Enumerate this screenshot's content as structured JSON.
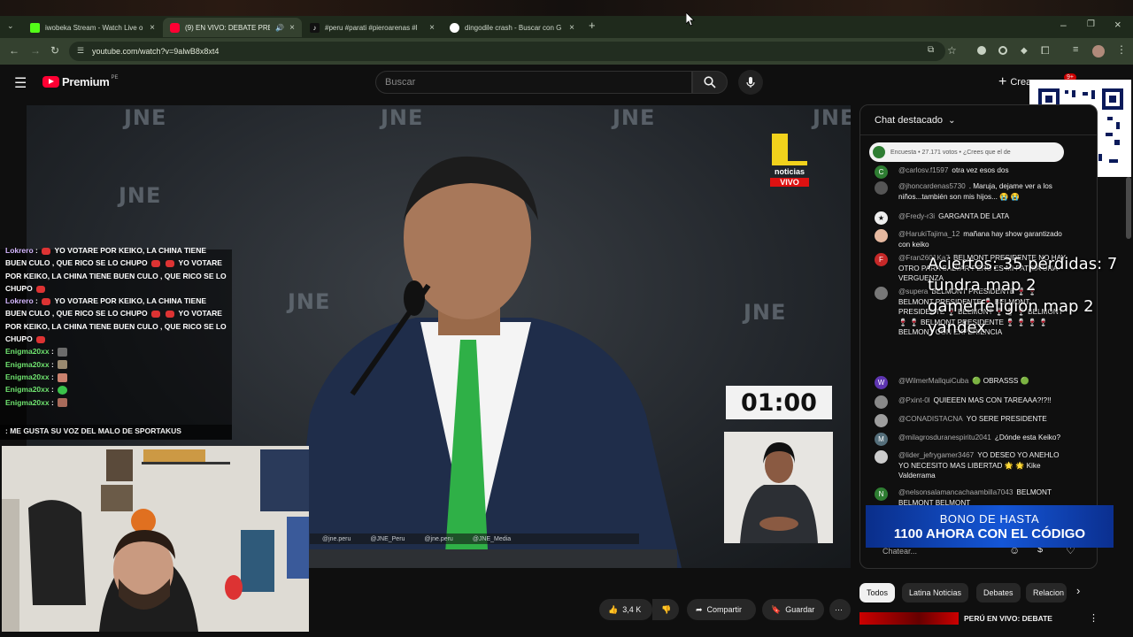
{
  "browser": {
    "tabs": [
      {
        "title": "iwobeka Stream - Watch Live o",
        "fav": "#53fc18",
        "active": false
      },
      {
        "title": "(9) EN VIVO: DEBATE PRESI",
        "fav": "#ff0033",
        "active": true
      },
      {
        "title": "#peru #parati #pieroarenas #l",
        "fav": "#111111",
        "active": false
      },
      {
        "title": "dingodile crash - Buscar con G",
        "fav": "#ffffff",
        "active": false
      }
    ],
    "url": "youtube.com/watch?v=9alwB8x8xt4"
  },
  "youtube": {
    "logo_text": "Premium",
    "region": "PE",
    "search_placeholder": "Buscar",
    "create_label": "Crear",
    "notif_count": "9+"
  },
  "video": {
    "watermark": "JNE",
    "channel_logo_label": "noticias",
    "channel_live_label": "VIVO",
    "timer": "01:00",
    "socials": [
      "@jne.peru",
      "@JNE_Peru",
      "@jne.peru",
      "@JNE_Media"
    ]
  },
  "overlay_chat": [
    {
      "user": "Lokrero",
      "text": "YO VOTARE POR KEIKO, LA CHINA TIENE BUEN CULO , QUE RICO SE LO CHUPO",
      "text2": "YO VOTARE POR KEIKO, LA CHINA TIENE BUEN CULO , QUE RICO SE LO CHUPO",
      "partial": true
    },
    {
      "user": "Lokrero",
      "text": "YO VOTARE POR KEIKO, LA CHINA TIENE BUEN CULO , QUE RICO SE LO CHUPO",
      "text2": "YO VOTARE POR KEIKO, LA CHINA TIENE BUEN CULO , QUE RICO SE LO CHUPO",
      "partial": false
    },
    {
      "user": "Enigma20xx",
      "emote": "#6b6b6b"
    },
    {
      "user": "Enigma20xx",
      "emote": "#9a8a70"
    },
    {
      "user": "Enigma20xx",
      "emote": "#c9816e"
    },
    {
      "user": "Enigma20xx",
      "emote": "#3ac24a"
    },
    {
      "user": "Enigma20xx",
      "emote": "#a86a5a"
    }
  ],
  "overlay_last": "ME GUSTA SU VOZ DEL MALO DE SPORTAKUS",
  "stream_overlay_text": [
    "Aciertos: 35 pérdidas: 7",
    "tundra map 2",
    "gamerfeligion map 2",
    "yandex"
  ],
  "chat": {
    "header": "Chat destacado",
    "poll": "Encuesta • 27.171 votos • ¿Crees que el de",
    "messages": [
      {
        "author": "@carlosv.f1597",
        "text": "otra vez esos dos",
        "color": "#2e7d32",
        "initial": "C"
      },
      {
        "author": "@jhoncardenas5730",
        "text": ". Maruja, dejame ver a los niños...también son mis hijos... 😭 😭",
        "color": "#555",
        "initial": ""
      },
      {
        "author": "@Fredy-r3i",
        "text": "GARGANTA DE LATA",
        "color": "#eee",
        "initial": "★"
      },
      {
        "author": "@HarukiTajima_12",
        "text": "mañana hay show garantizado con keiko",
        "color": "#e6b9a0",
        "initial": ""
      },
      {
        "author": "@Fran2601Ka7",
        "text": "BELMONT PRESIDENTE NO HAY OTRO PARA SALVAR PERÚ ES MI PATRIA UNA VERGUENZA",
        "color": "#c62828",
        "initial": "F"
      },
      {
        "author": "@supera",
        "text": "BELMONT PRESIDENTE 🍷 🍷 BELMONT PRESIDENTE 🍷 BELMONT PRESIDENTE 🍷 BELMONT 🍷 🍷 🍷 BELMONT 🍷 🍷 BELMONT PRESIDENTE 🍷 🍷 🍷 🍷 BELMONT CON EXPERIENCIA",
        "color": "#777",
        "initial": ""
      },
      {
        "author": "@WilmerMallquiCuba",
        "text": "🟢 OBRASSS 🟢",
        "color": "#5e35b1",
        "initial": "W"
      },
      {
        "author": "@Pxint-0l",
        "text": "QUIEEEN MAS CON TAREAAA?!?!!",
        "color": "#888",
        "initial": ""
      },
      {
        "author": "@CONADISTACNA",
        "text": "YO SERE PRESIDENTE",
        "color": "#9e9e9e",
        "initial": ""
      },
      {
        "author": "@milagrosduranespiritu2041",
        "text": "¿Dónde esta Keiko?",
        "color": "#546e7a",
        "initial": "M"
      },
      {
        "author": "@lider_jefrygamer3467",
        "text": "YO DESEO YO ANEHLO YO NECESITO MAS LIBERTAD 🌟 🌟 Kike Valderrama",
        "color": "#ccc",
        "initial": ""
      },
      {
        "author": "@nelsonsalamancachaambilla7043",
        "text": "BELMONT BELMONT BELMONT",
        "color": "#2e7d32",
        "initial": "N"
      }
    ],
    "input_placeholder": "Chatear..."
  },
  "promo": {
    "line1": "BONO DE HASTA",
    "line2": "1100 AHORA CON EL CÓDIGO"
  },
  "actions": {
    "likes": "3,4 K",
    "share": "Compartir",
    "save": "Guardar"
  },
  "chips": [
    "Todos",
    "Latina Noticias",
    "Debates",
    "Relacion"
  ],
  "related_title": "PERÚ EN VIVO: DEBATE"
}
